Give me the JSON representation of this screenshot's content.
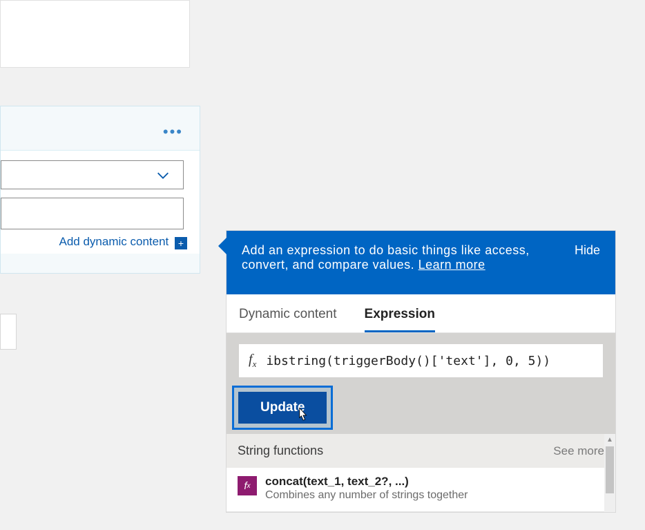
{
  "left": {
    "add_dynamic_label": "Add dynamic content"
  },
  "panel": {
    "header_text": "Add an expression to do basic things like access, convert, and compare values. ",
    "learn_more": "Learn more",
    "hide_label": "Hide",
    "tabs": {
      "dynamic": "Dynamic content",
      "expression": "Expression"
    },
    "expression_value": "ibstring(triggerBody()['text'], 0, 5))",
    "update_label": "Update",
    "functions": {
      "group_label": "String functions",
      "see_more": "See more",
      "items": [
        {
          "title": "concat(text_1, text_2?, ...)",
          "desc": "Combines any number of strings together"
        }
      ]
    }
  }
}
